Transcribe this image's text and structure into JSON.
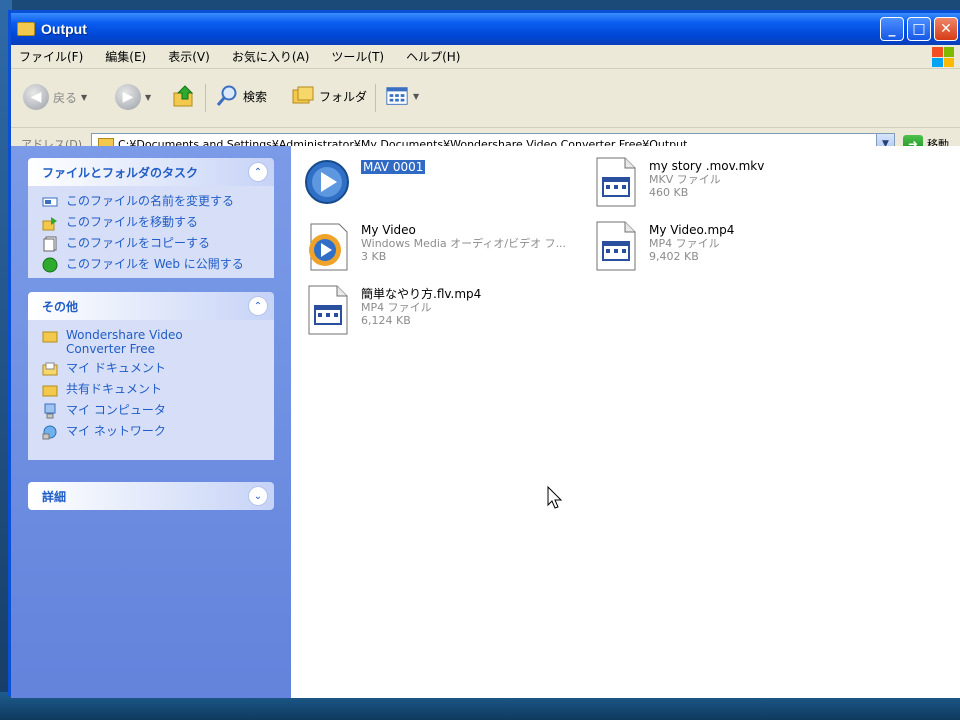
{
  "window": {
    "title": "Output",
    "buttons": {
      "minimize": "_",
      "maximize": "□",
      "close": "✕"
    }
  },
  "menu": [
    "ファイル(F)",
    "編集(E)",
    "表示(V)",
    "お気に入り(A)",
    "ツール(T)",
    "ヘルプ(H)"
  ],
  "toolbar": {
    "back_label": "戻る",
    "search_label": "検索",
    "folders_label": "フォルダ"
  },
  "address": {
    "label": "アドレス(D)",
    "path": "C:¥Documents and Settings¥Administrator¥My Documents¥Wondershare Video Converter Free¥Output",
    "go_label": "移動"
  },
  "sidebar": {
    "tasks": {
      "title": "ファイルとフォルダのタスク",
      "items": [
        {
          "label": "このファイルの名前を変更する",
          "icon": "rename-icon"
        },
        {
          "label": "このファイルを移動する",
          "icon": "move-icon"
        },
        {
          "label": "このファイルをコピーする",
          "icon": "copy-icon"
        },
        {
          "label": "このファイルを Web に公開する",
          "icon": "publish-icon"
        }
      ]
    },
    "other": {
      "title": "その他",
      "items": [
        {
          "label": "Wondershare Video Converter Free",
          "icon": "folder-icon"
        },
        {
          "label": "マイ ドキュメント",
          "icon": "my-documents-icon"
        },
        {
          "label": "共有ドキュメント",
          "icon": "shared-documents-icon"
        },
        {
          "label": "マイ コンピュータ",
          "icon": "my-computer-icon"
        },
        {
          "label": "マイ ネットワーク",
          "icon": "my-network-icon"
        }
      ]
    },
    "details": {
      "title": "詳細"
    }
  },
  "files": [
    {
      "name": "MAV 0001",
      "type": "",
      "size": "",
      "icon": "media-player-icon",
      "selected": true
    },
    {
      "name": "my story .mov.mkv",
      "type": "MKV ファイル",
      "size": "460 KB",
      "icon": "video-file-icon",
      "selected": false
    },
    {
      "name": "My Video",
      "type": "Windows Media オーディオ/ビデオ フ...",
      "size": "3 KB",
      "icon": "media-player-icon",
      "selected": false
    },
    {
      "name": "My Video.mp4",
      "type": "MP4 ファイル",
      "size": "9,402 KB",
      "icon": "video-file-icon",
      "selected": false
    },
    {
      "name": "簡単なやり方.flv.mp4",
      "type": "MP4 ファイル",
      "size": "6,124 KB",
      "icon": "video-file-icon",
      "selected": false
    }
  ]
}
